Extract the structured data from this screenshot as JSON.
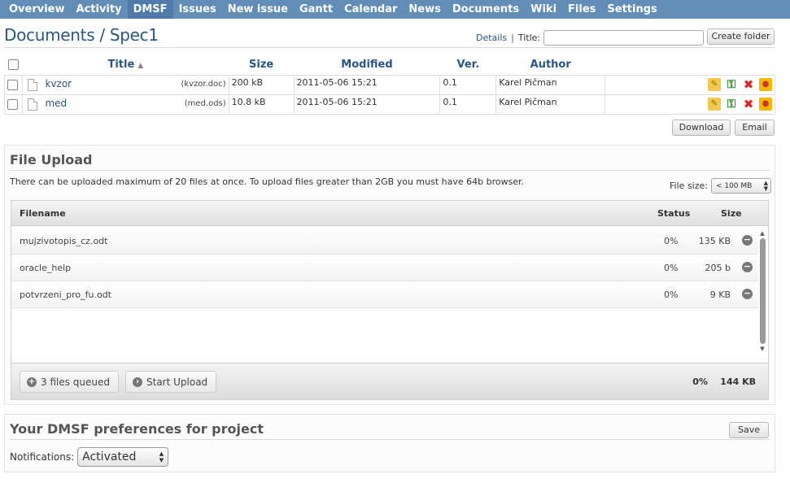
{
  "nav": {
    "tabs": [
      {
        "label": "Overview"
      },
      {
        "label": "Activity"
      },
      {
        "label": "DMSF",
        "selected": true
      },
      {
        "label": "Issues"
      },
      {
        "label": "New issue"
      },
      {
        "label": "Gantt"
      },
      {
        "label": "Calendar"
      },
      {
        "label": "News"
      },
      {
        "label": "Documents"
      },
      {
        "label": "Wiki"
      },
      {
        "label": "Files"
      },
      {
        "label": "Settings"
      }
    ]
  },
  "header": {
    "title": "Documents / Spec1",
    "details_link": "Details",
    "separator": "|",
    "title_label": "Title:",
    "title_value": "",
    "create_folder": "Create folder"
  },
  "documents": {
    "columns": {
      "title": "Title",
      "size": "Size",
      "modified": "Modified",
      "ver": "Ver.",
      "author": "Author"
    },
    "rows": [
      {
        "name": "kvzor",
        "file": "(kvzor.doc)",
        "size": "200 kB",
        "modified": "2011-05-06 15:21",
        "version": "0.1",
        "author": "Karel Pičman"
      },
      {
        "name": "med",
        "file": "(med.ods)",
        "size": "10.8 kB",
        "modified": "2011-05-06 15:21",
        "version": "0.1",
        "author": "Karel Pičman"
      }
    ],
    "download": "Download",
    "email": "Email"
  },
  "upload": {
    "title": "File Upload",
    "note": "There can be uploaded maximum of 20 files at once. To upload files greater than 2GB you must have 64b browser.",
    "file_size_label": "File size:",
    "file_size_value": "< 100 MB",
    "columns": {
      "filename": "Filename",
      "status": "Status",
      "size": "Size"
    },
    "files": [
      {
        "name": "mujzivotopis_cz.odt",
        "status": "0%",
        "size": "135 KB"
      },
      {
        "name": "oracle_help",
        "status": "0%",
        "size": "205 b"
      },
      {
        "name": "potvrzeni_pro_fu.odt",
        "status": "0%",
        "size": "9 KB"
      }
    ],
    "queued": "3 files queued",
    "start": "Start Upload",
    "total_status": "0%",
    "total_size": "144 KB"
  },
  "preferences": {
    "title": "Your DMSF preferences for project",
    "save": "Save",
    "notifications_label": "Notifications:",
    "notifications_value": "Activated"
  }
}
